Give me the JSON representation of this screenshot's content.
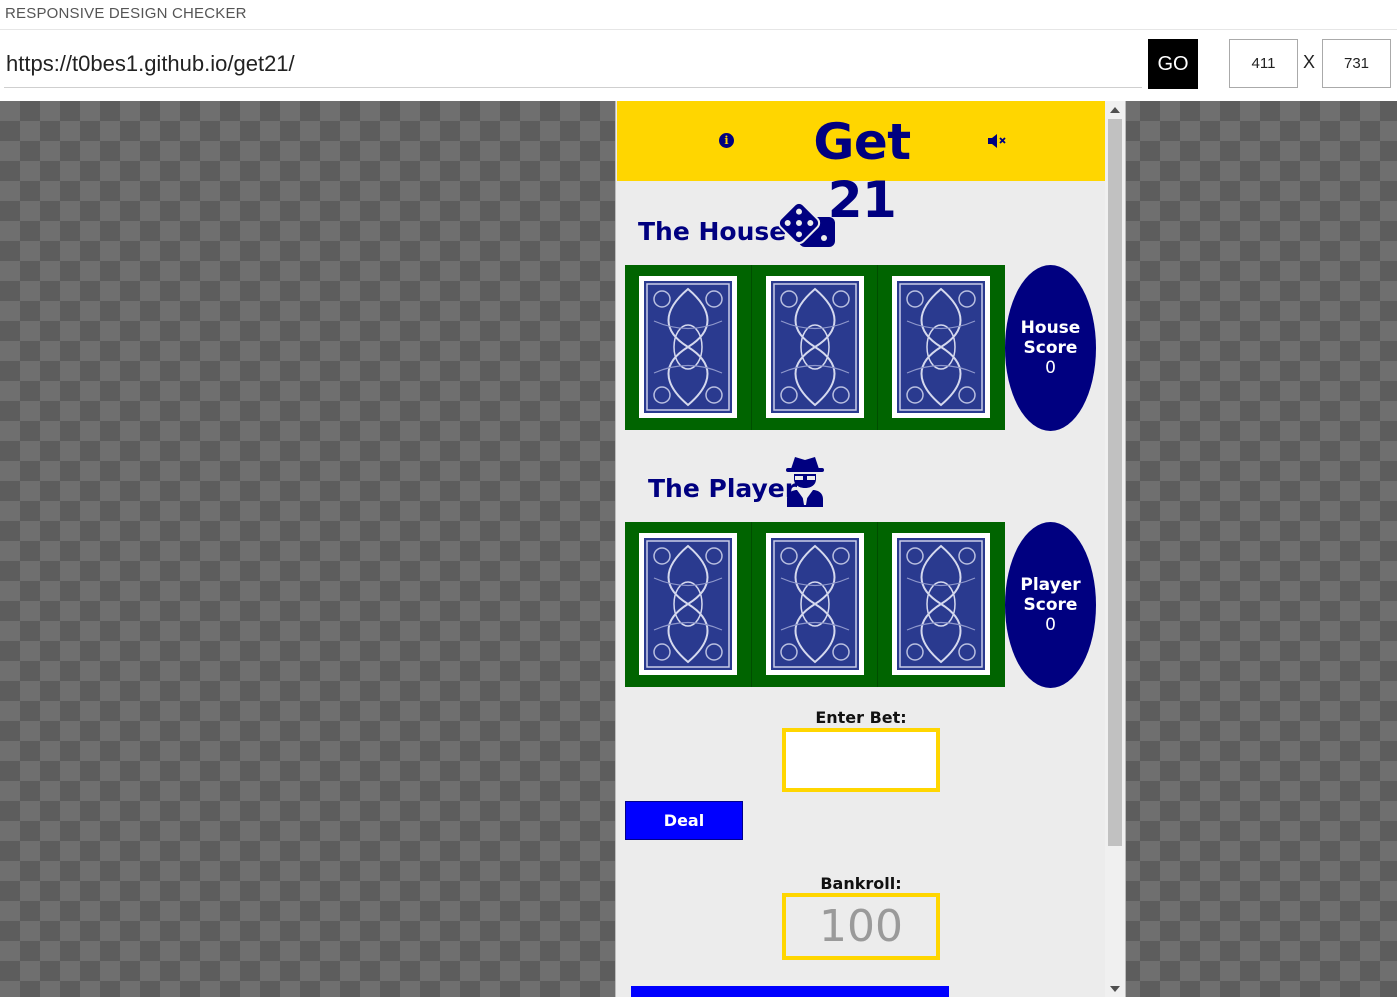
{
  "app": {
    "title": "RESPONSIVE DESIGN CHECKER"
  },
  "toolbar": {
    "url_value": "https://t0bes1.github.io/get21/",
    "go_label": "GO",
    "width_value": "411",
    "separator": "X",
    "height_value": "731"
  },
  "game": {
    "title": "Get 21",
    "house": {
      "heading": "The House",
      "heading_icon": "dice-icon",
      "score_label_line1": "House",
      "score_label_line2": "Score",
      "score_value": "0",
      "cards": [
        "card-back",
        "card-back",
        "card-back"
      ]
    },
    "player": {
      "heading": "The Player",
      "heading_icon": "user-secret-icon",
      "score_label_line1": "Player",
      "score_label_line2": "Score",
      "score_value": "0",
      "cards": [
        "card-back",
        "card-back",
        "card-back"
      ]
    },
    "bet": {
      "label": "Enter Bet:",
      "value": ""
    },
    "deal_label": "Deal",
    "bankroll": {
      "label": "Bankroll:",
      "value": "100"
    },
    "colors": {
      "header_bg": "#ffd600",
      "navy": "#000080",
      "table_green": "#006400",
      "button_blue": "#0000ff",
      "frame_bg": "#ececec"
    }
  }
}
